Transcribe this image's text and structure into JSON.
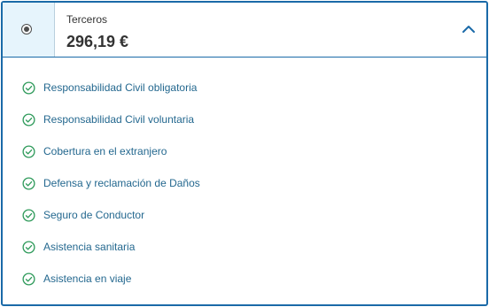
{
  "plan": {
    "name": "Terceros",
    "price": "296,19 €",
    "selected": true,
    "expanded": true
  },
  "icons": {
    "radio": "radio-selected-icon",
    "toggle": "chevron-up-icon",
    "feature": "check-circle-icon"
  },
  "colors": {
    "border": "#1a6aa8",
    "header_bg": "#e6f4fc",
    "check": "#2e9a5a",
    "feature_text": "#24688f",
    "text": "#333333"
  },
  "features": [
    {
      "label": "Responsabilidad Civil obligatoria"
    },
    {
      "label": "Responsabilidad Civil voluntaria"
    },
    {
      "label": "Cobertura en el extranjero"
    },
    {
      "label": "Defensa y reclamación de Daños"
    },
    {
      "label": "Seguro de Conductor"
    },
    {
      "label": "Asistencia sanitaria"
    },
    {
      "label": "Asistencia en viaje"
    }
  ]
}
